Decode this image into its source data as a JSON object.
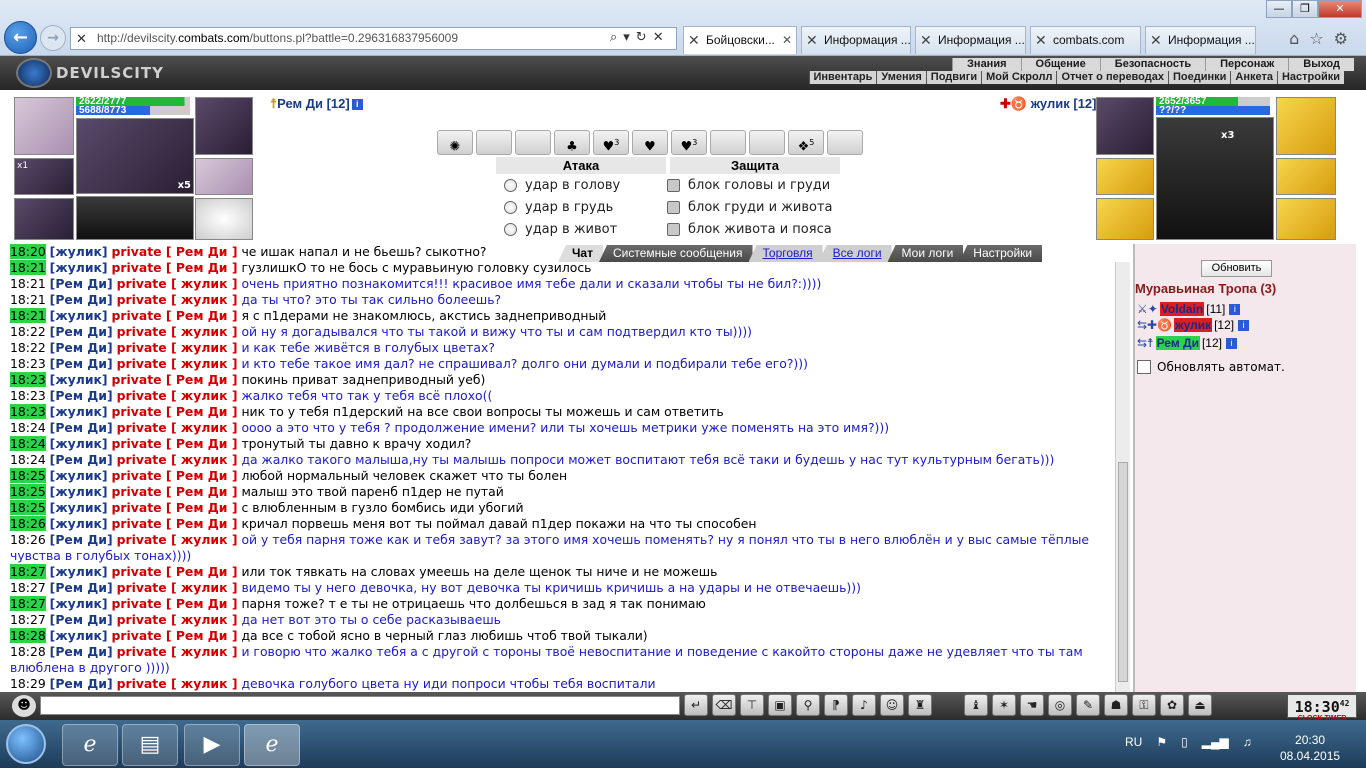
{
  "browser": {
    "url_pre": "http://devilscity.",
    "url_domain": "combats.com",
    "url_post": "/buttons.pl?battle=0.296316837956009",
    "tabs": [
      {
        "label": "Бойцовски...",
        "active": true
      },
      {
        "label": "Информация ..."
      },
      {
        "label": "Информация ..."
      },
      {
        "label": "combats.com"
      },
      {
        "label": "Информация ..."
      }
    ]
  },
  "header": {
    "logo": "DEVILSCITY",
    "menu_top": [
      "Знания",
      "Общение",
      "Безопасность",
      "Персонаж",
      "Выход"
    ],
    "menu_bottom": [
      "Инвентарь",
      "Умения",
      "Подвиги",
      "Мой Скролл",
      "Отчет о переводах",
      "Поединки",
      "Анкета",
      "Настройки"
    ]
  },
  "combat": {
    "me": {
      "name": "Рем Ди [12]",
      "hp": "2622/2777",
      "mana": "5688/8773"
    },
    "enemy": {
      "name": "жулик [12]",
      "hp": "2652/3657",
      "mana": "??/??"
    },
    "attack_title": "Атака",
    "defense_title": "Защита",
    "attacks": [
      "удар в голову",
      "удар в грудь",
      "удар в живот"
    ],
    "defenses": [
      "блок головы и груди",
      "блок груди и живота",
      "блок живота и пояса"
    ],
    "scroll_counts": [
      "",
      "",
      "",
      "",
      "3",
      "",
      "3",
      "",
      "",
      "5",
      ""
    ],
    "me_slot_count": "x5",
    "me_slot_count2": "x1",
    "enemy_slot_count": "x3"
  },
  "chat_tabs": [
    "Чат",
    "Системные сообщения",
    "Торговля",
    "Все логи",
    "Мои логи",
    "Настройки"
  ],
  "chat": [
    {
      "time": "18:20",
      "g": true,
      "from": "жулик",
      "to": "Рем Ди",
      "c": "k",
      "text": "че ишак напал и не бьешь? сыкотно?"
    },
    {
      "time": "18:21",
      "g": true,
      "from": "жулик",
      "to": "Рем Ди",
      "c": "k",
      "text": "гузлишкО то не бось с муравьиную головку сузилось"
    },
    {
      "time": "18:21",
      "g": false,
      "from": "Рем Ди",
      "to": "жулик",
      "c": "b",
      "text": "очень приятно познакомится!!! красивое имя тебе дали и сказали чтобы ты не бил?:))))"
    },
    {
      "time": "18:21",
      "g": false,
      "from": "Рем Ди",
      "to": "жулик",
      "c": "b",
      "text": "да ты что? это ты так сильно болеешь?"
    },
    {
      "time": "18:21",
      "g": true,
      "from": "жулик",
      "to": "Рем Ди",
      "c": "k",
      "text": "я с п1дерами не знакомлюсь, акстись заднеприводный"
    },
    {
      "time": "18:22",
      "g": false,
      "from": "Рем Ди",
      "to": "жулик",
      "c": "b",
      "text": "ой ну я догадывался что ты такой и вижу что ты и сам подтвердил кто ты))))"
    },
    {
      "time": "18:22",
      "g": false,
      "from": "Рем Ди",
      "to": "жулик",
      "c": "b",
      "text": "и как тебе живётся в голубых цветах?"
    },
    {
      "time": "18:23",
      "g": false,
      "from": "Рем Ди",
      "to": "жулик",
      "c": "b",
      "text": "и кто тебе такое имя дал? не спрашивал? долго они думали и подбирали тебе его?)))"
    },
    {
      "time": "18:23",
      "g": true,
      "from": "жулик",
      "to": "Рем Ди",
      "c": "k",
      "text": "покинь приват заднеприводный уеб)"
    },
    {
      "time": "18:23",
      "g": false,
      "from": "Рем Ди",
      "to": "жулик",
      "c": "b",
      "text": "жалко тебя что так у тебя всё плохо(("
    },
    {
      "time": "18:23",
      "g": true,
      "from": "жулик",
      "to": "Рем Ди",
      "c": "k",
      "text": "ник то у тебя п1дерский на все свои вопросы ты можешь и сам ответить"
    },
    {
      "time": "18:24",
      "g": false,
      "from": "Рем Ди",
      "to": "жулик",
      "c": "b",
      "text": "оооо а это что у тебя ? продолжение имени? или ты хочешь метрики уже поменять на это имя?)))"
    },
    {
      "time": "18:24",
      "g": true,
      "from": "жулик",
      "to": "Рем Ди",
      "c": "k",
      "text": "тронутый ты давно к врачу ходил?"
    },
    {
      "time": "18:24",
      "g": false,
      "from": "Рем Ди",
      "to": "жулик",
      "c": "b",
      "text": "да жалко такого малыша,ну ты малышь попроси может воспитают тебя всё таки и будешь у нас тут культурным бегать)))"
    },
    {
      "time": "18:25",
      "g": true,
      "from": "жулик",
      "to": "Рем Ди",
      "c": "k",
      "text": "любой нормальный человек скажет что ты болен"
    },
    {
      "time": "18:25",
      "g": true,
      "from": "жулик",
      "to": "Рем Ди",
      "c": "k",
      "text": "малыш это твой паренб п1дер не путай"
    },
    {
      "time": "18:25",
      "g": true,
      "from": "жулик",
      "to": "Рем Ди",
      "c": "k",
      "text": "с влюбленным в гузло бомбись иди убогий"
    },
    {
      "time": "18:26",
      "g": true,
      "from": "жулик",
      "to": "Рем Ди",
      "c": "k",
      "text": "кричал порвешь меня вот ты поймал давай п1дер покажи на что ты способен"
    },
    {
      "time": "18:26",
      "g": false,
      "from": "Рем Ди",
      "to": "жулик",
      "c": "b",
      "text": "ой у тебя парня тоже как и тебя завут? за этого имя хочешь поменять? ну я понял что ты в него влюблён и у выс самые тёплые чувства в голубых тонах))))"
    },
    {
      "time": "18:27",
      "g": true,
      "from": "жулик",
      "to": "Рем Ди",
      "c": "k",
      "text": "или ток тявкать на словах умеешь на деле щенок ты ниче и не можешь"
    },
    {
      "time": "18:27",
      "g": false,
      "from": "Рем Ди",
      "to": "жулик",
      "c": "b",
      "text": "видемо ты у него девочка, ну вот девочка ты кричишь кричишь а на удары и не отвечаешь)))"
    },
    {
      "time": "18:27",
      "g": true,
      "from": "жулик",
      "to": "Рем Ди",
      "c": "k",
      "text": "парня тоже? т е ты не отрицаешь что долбешься в зад я так понимаю"
    },
    {
      "time": "18:27",
      "g": false,
      "from": "Рем Ди",
      "to": "жулик",
      "c": "b",
      "text": "да нет вот это ты о себе расказываешь"
    },
    {
      "time": "18:28",
      "g": true,
      "from": "жулик",
      "to": "Рем Ди",
      "c": "k",
      "text": "да все с тобой ясно в черный глаз любишь чтоб твой тыкали)"
    },
    {
      "time": "18:28",
      "g": false,
      "from": "Рем Ди",
      "to": "жулик",
      "c": "b",
      "text": "и говорю что жалко тебя а с другой с тороны твоё невоспитание и поведение с какойто стороны даже не удевляет что ты там влюблена в другого )))))"
    },
    {
      "time": "18:29",
      "g": false,
      "from": "Рем Ди",
      "to": "жулик",
      "c": "b",
      "text": "девочка голубого цвета ну иди попроси чтобы тебя воспитали"
    }
  ],
  "private_word": "private",
  "right_panel": {
    "refresh": "Обновить",
    "location": "Муравьиная Тропа (3)",
    "players": [
      {
        "name": "Voldain",
        "level": "[11]",
        "bg": "#e01c1c",
        "color": "#1a2a8a"
      },
      {
        "name": "жулик",
        "level": "[12]",
        "bg": "#e01c1c",
        "color": "#1a2a8a"
      },
      {
        "name": "Рем Ди",
        "level": "[12]",
        "bg": "#2bd24a",
        "color": "#1a2a8a"
      }
    ],
    "auto_refresh": "Обновлять автомат."
  },
  "bottom": {
    "clock": "18:30",
    "clock_sec": "42",
    "clock_labels": "CLOCK TIMER"
  },
  "taskbar": {
    "lang": "RU",
    "time": "20:30",
    "date": "08.04.2015"
  }
}
